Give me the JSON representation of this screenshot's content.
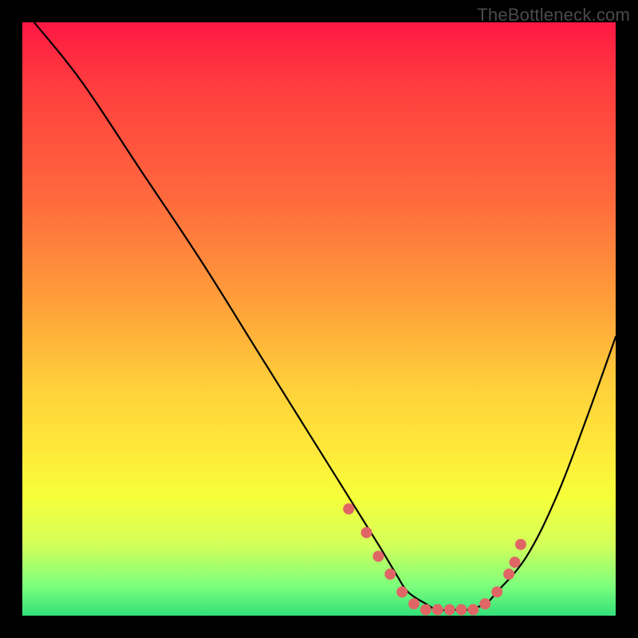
{
  "watermark": "TheBottleneck.com",
  "chart_data": {
    "type": "line",
    "title": "",
    "xlabel": "",
    "ylabel": "",
    "xlim": [
      0,
      100
    ],
    "ylim": [
      0,
      100
    ],
    "series": [
      {
        "name": "bottleneck-curve",
        "x": [
          2,
          10,
          20,
          30,
          40,
          50,
          55,
          60,
          63,
          65,
          68,
          70,
          73,
          75,
          78,
          80,
          85,
          90,
          95,
          100
        ],
        "values": [
          100,
          90,
          75,
          60,
          44,
          28,
          20,
          12,
          7,
          4,
          2,
          1,
          1,
          1,
          2,
          4,
          10,
          20,
          33,
          47
        ]
      }
    ],
    "markers": {
      "name": "highlight-dots",
      "x": [
        55,
        58,
        60,
        62,
        64,
        66,
        68,
        70,
        72,
        74,
        76,
        78,
        80,
        82,
        83,
        84
      ],
      "values": [
        18,
        14,
        10,
        7,
        4,
        2,
        1,
        1,
        1,
        1,
        1,
        2,
        4,
        7,
        9,
        12
      ],
      "color": "#e06666",
      "radius": 7
    },
    "gradient_stops": [
      {
        "pct": 0,
        "color": "#ff1744"
      },
      {
        "pct": 10,
        "color": "#ff3b3f"
      },
      {
        "pct": 30,
        "color": "#ff6a3d"
      },
      {
        "pct": 48,
        "color": "#ffa23a"
      },
      {
        "pct": 62,
        "color": "#ffd23a"
      },
      {
        "pct": 72,
        "color": "#ffe83a"
      },
      {
        "pct": 80,
        "color": "#f6ff3a"
      },
      {
        "pct": 88,
        "color": "#d4ff5a"
      },
      {
        "pct": 95,
        "color": "#7cff7c"
      },
      {
        "pct": 100,
        "color": "#33e07a"
      }
    ]
  }
}
